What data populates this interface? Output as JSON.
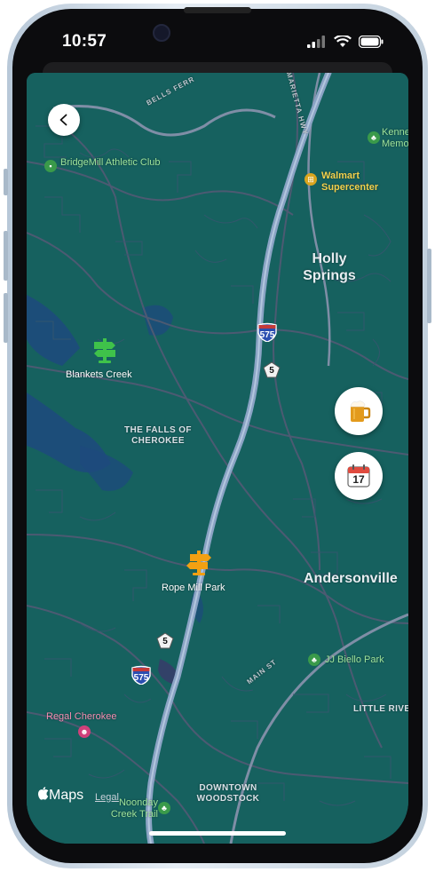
{
  "status_bar": {
    "time": "10:57"
  },
  "map": {
    "brand": "Maps",
    "legal": "Legal",
    "streets": {
      "bells_ferry": "BELLS FERR",
      "marietta_hwy": "MARIETTA HWY",
      "main_st": "MAIN ST"
    },
    "places": {
      "holly_springs": "Holly Springs",
      "andersonville": "Andersonville",
      "falls_of_cherokee": "THE FALLS OF CHEROKEE",
      "downtown_woodstock": "DOWNTOWN WOODSTOCK",
      "little_river": "LITTLE RIVER",
      "kennesaw_memorial": "Kenne Memo"
    },
    "pois": {
      "bridgemill": "BridgeMill Athletic Club",
      "walmart": "Walmart Supercenter",
      "jj_biello": "JJ Biello Park",
      "regal": "Regal Cherokee",
      "noonday": "Noonday Creek Trail"
    },
    "trail_markers": {
      "blankets_creek": "Blankets Creek",
      "rope_mill": "Rope Mill Park"
    },
    "shields": {
      "i575_top": "575",
      "i575_bottom": "575",
      "sr5_top": "5",
      "sr5_bottom": "5"
    }
  },
  "colors": {
    "map_bg": "#16615f",
    "road": "#56657a",
    "highway": "#8aa3c4",
    "water": "#1f3f8a",
    "trail_green": "#3fc24a",
    "trail_orange": "#f2a012"
  },
  "buttons": {
    "back": "chevron-left-icon",
    "beer": "beer-mug-icon",
    "calendar": "calendar-icon",
    "calendar_day": "17"
  }
}
